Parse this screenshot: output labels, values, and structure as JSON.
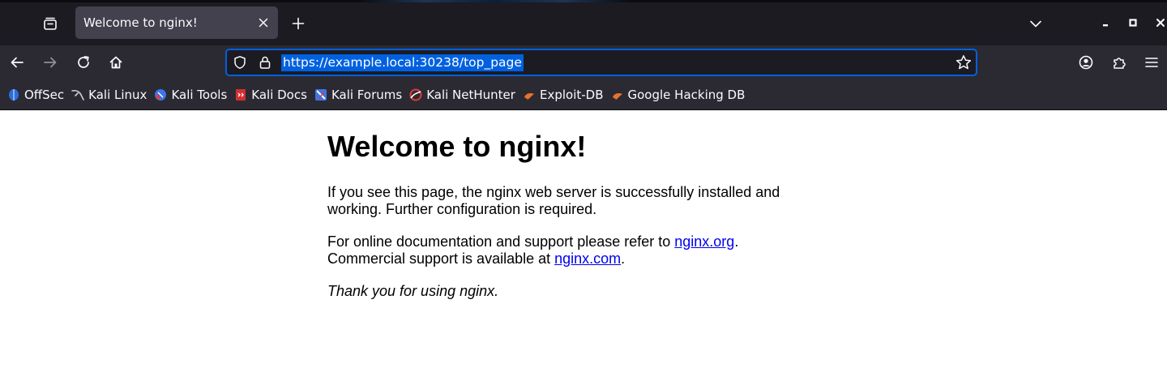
{
  "tab": {
    "title": "Welcome to nginx!"
  },
  "urlbar": {
    "url": "https://example.local:30238/top_page"
  },
  "bookmarks": [
    {
      "label": "OffSec",
      "icon": "offsec-icon",
      "color": "#2f6bd6"
    },
    {
      "label": "Kali Linux",
      "icon": "kali-dragon-icon",
      "color": "#d0d0d0"
    },
    {
      "label": "Kali Tools",
      "icon": "kali-tools-icon",
      "color": "#3a76e8"
    },
    {
      "label": "Kali Docs",
      "icon": "kali-docs-icon",
      "color": "#d32f2f"
    },
    {
      "label": "Kali Forums",
      "icon": "kali-forums-icon",
      "color": "#3a76e8"
    },
    {
      "label": "Kali NetHunter",
      "icon": "nethunter-icon",
      "color": "#e53935"
    },
    {
      "label": "Exploit-DB",
      "icon": "exploit-db-icon",
      "color": "#e8732a"
    },
    {
      "label": "Google Hacking DB",
      "icon": "ghdb-icon",
      "color": "#e8732a"
    }
  ],
  "page": {
    "heading": "Welcome to nginx!",
    "p1": "If you see this page, the nginx web server is successfully installed and working. Further configuration is required.",
    "p2_prefix": "For online documentation and support please refer to ",
    "p2_link1": "nginx.org",
    "p2_mid": ".",
    "p2_line2": "Commercial support is available at ",
    "p2_link2": "nginx.com",
    "p2_end": ".",
    "p3": "Thank you for using nginx."
  },
  "colors": {
    "accent": "#0061e0",
    "link": "#0000ee",
    "toolbar": "#2b2a33",
    "tabstrip": "#1c1b22"
  }
}
